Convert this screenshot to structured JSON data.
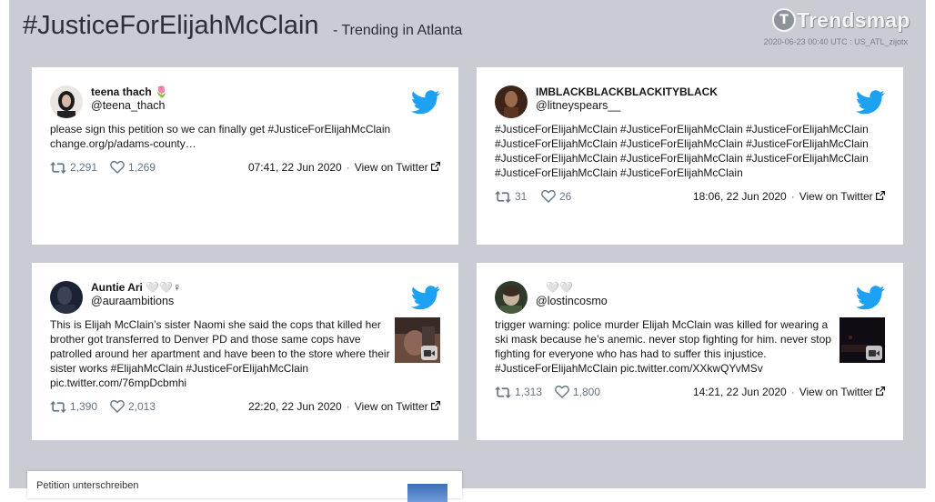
{
  "header": {
    "hashtag": "#JusticeForElijahMcClain",
    "trending": "- Trending in Atlanta",
    "logo_text": "Trendsmap",
    "stamp": "2020-06-23 00:40 UTC : US_ATL_zijotx"
  },
  "view_on_twitter": "View on Twitter",
  "separator": "·",
  "tweets": [
    {
      "name": "teena thach 🌷",
      "handle": "@teena_thach",
      "text": "please sign this petition so we can finally get #JusticeForElijahMcClain change.org/p/adams-county…",
      "retweets": "2,291",
      "likes": "1,269",
      "time": "07:41, 22 Jun 2020",
      "has_media": false
    },
    {
      "name": "IMBLACKBLACKBLACKITYBLACK",
      "handle": "@litneyspears__",
      "text": "#JusticeForElijahMcClain #JusticeForElijahMcClain #JusticeForElijahMcClain #JusticeForElijahMcClain #JusticeForElijahMcClain #JusticeForElijahMcClain #JusticeForElijahMcClain #JusticeForElijahMcClain #JusticeForElijahMcClain #JusticeForElijahMcClain #JusticeForElijahMcClain",
      "retweets": "31",
      "likes": "26",
      "time": "18:06, 22 Jun 2020",
      "has_media": false
    },
    {
      "name": "Auntie Ari 🤍🤍♀",
      "handle": "@auraambitions",
      "text": "This is Elijah McClain’s sister Naomi she said the cops that killed her brother got transferred to Denver PD and those same cops have patrolled around her apartment and have been to the store where their sister works #ElijahMcClain #JusticeForElijahMcClain pic.twitter.com/76mpDcbmhi",
      "retweets": "1,390",
      "likes": "2,013",
      "time": "22:20, 22 Jun 2020",
      "has_media": true
    },
    {
      "name": "🤍🤍",
      "handle": "@lostincosmo",
      "text": "trigger warning: police murder Elijah McClain was killed for wearing a ski mask because he’s anemic. never stop fighting for him. never stop fighting for everyone who has had to suffer this injustice. #JusticeForElijahMcClain pic.twitter.com/XXkwQYvMSv",
      "retweets": "1,313",
      "likes": "1,800",
      "time": "14:21, 22 Jun 2020",
      "has_media": true
    }
  ],
  "petition": {
    "label": "Petition unterschreiben"
  },
  "colors": {
    "background": "#c9ccd3",
    "card": "#ffffff",
    "twitter_blue": "#1da1f2",
    "muted": "#657786"
  }
}
